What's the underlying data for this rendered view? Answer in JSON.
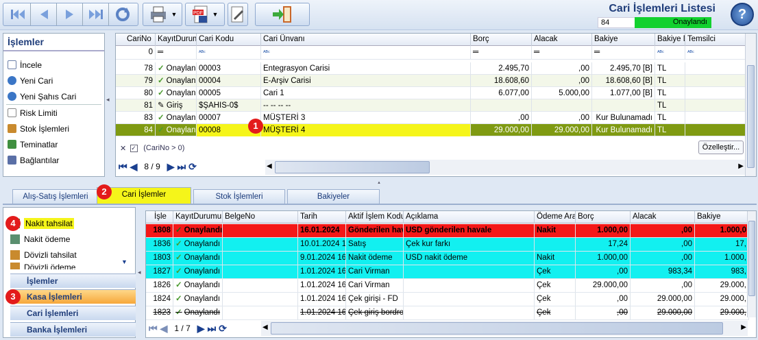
{
  "header": {
    "title": "Cari İşlemleri Listesi",
    "count": "84",
    "status": "Onaylandı"
  },
  "left_panel": {
    "title": "İşlemler",
    "items": [
      {
        "label": "İncele",
        "icon": "list-icon",
        "color": "#6b7fa8"
      },
      {
        "label": "Yeni Cari",
        "icon": "add-icon",
        "color": "#3b76c6"
      },
      {
        "label": "Yeni Şahıs Cari",
        "icon": "add-icon",
        "color": "#3b76c6"
      },
      {
        "label": "Risk Limiti",
        "icon": "limit-icon",
        "color": "#8e8e8e"
      },
      {
        "label": "Stok İşlemleri",
        "icon": "stock-icon",
        "color": "#c98a2e"
      },
      {
        "label": "Teminatlar",
        "icon": "money-icon",
        "color": "#3f8f3f"
      },
      {
        "label": "Bağlantılar",
        "icon": "link-icon",
        "color": "#5a6fa6"
      }
    ]
  },
  "top_grid": {
    "columns": [
      "CariNo",
      "KayıtDurumu",
      "Cari Kodu",
      "Cari Ünvanı",
      "Borç",
      "Alacak",
      "Bakiye",
      "Bakiye D",
      "Temsilci"
    ],
    "filter_row": {
      "carino": "0"
    },
    "rows": [
      {
        "carino": "78",
        "durum": "Onaylan",
        "kod": "00003",
        "unvan": "Entegrasyon Carisi",
        "borc": "2.495,70",
        "alacak": ",00",
        "bakiye": "2.495,70 [B]",
        "bd": "TL",
        "temsilci": ""
      },
      {
        "carino": "79",
        "durum": "Onaylan",
        "kod": "00004",
        "unvan": "E-Arşiv Carisi",
        "borc": "18.608,60",
        "alacak": ",00",
        "bakiye": "18.608,60 [B]",
        "bd": "TL",
        "temsilci": ""
      },
      {
        "carino": "80",
        "durum": "Onaylan",
        "kod": "00005",
        "unvan": "Cari 1",
        "borc": "6.077,00",
        "alacak": "5.000,00",
        "bakiye": "1.077,00 [B]",
        "bd": "TL",
        "temsilci": ""
      },
      {
        "carino": "81",
        "durum": "Giriş",
        "kod": "$ŞAHIS-0$",
        "unvan": "-- -- -- --",
        "borc": "",
        "alacak": "",
        "bakiye": "",
        "bd": "TL",
        "temsilci": ""
      },
      {
        "carino": "83",
        "durum": "Onaylan",
        "kod": "00007",
        "unvan": "MÜŞTERİ 3",
        "borc": ",00",
        "alacak": ",00",
        "bakiye": "Kur Bulunamadı",
        "bd": "TL",
        "temsilci": ""
      },
      {
        "carino": "84",
        "durum": "Onaylan",
        "kod": "00008",
        "unvan": "MÜŞTERİ 4",
        "borc": "29.000,00",
        "alacak": "29.000,00",
        "bakiye": "Kur Bulunamadı",
        "bd": "TL",
        "temsilci": ""
      }
    ],
    "filter_text": "(CariNo > 0)",
    "customize": "Özelleştir...",
    "page": "8 / 9"
  },
  "tabs": [
    "Alış-Satış İşlemleri",
    "Cari İşlemler",
    "Stok İşlemleri",
    "Bakiyeler"
  ],
  "bottom_left": {
    "items": [
      "Nakit tahsilat",
      "Nakit ödeme",
      "Dövizli tahsilat",
      "Dövizli ödeme"
    ],
    "nav": [
      "İşlemler",
      "Kasa İşlemleri",
      "Cari İşlemleri",
      "Banka İşlemleri"
    ]
  },
  "bottom_grid": {
    "columns": [
      "İşle",
      "KayıtDurumu",
      "BelgeNo",
      "Tarih",
      "Aktif İşlem Kodu",
      "Açıklama",
      "Ödeme Ara",
      "Borç",
      "Alacak",
      "Bakiye"
    ],
    "rows": [
      {
        "no": "1808",
        "durum": "Onaylandı",
        "belge": "",
        "tarih": "16.01.2024",
        "kod": "Gönderilen hav",
        "acik": "USD gönderilen havale",
        "odeme": "Nakit",
        "borc": "1.000,00",
        "alacak": ",00",
        "bakiye": "1.000,0"
      },
      {
        "no": "1836",
        "durum": "Onaylandı",
        "belge": "",
        "tarih": "10.01.2024 1",
        "kod": "Satış",
        "acik": "Çek kur farkı",
        "odeme": "",
        "borc": "17,24",
        "alacak": ",00",
        "bakiye": "17,"
      },
      {
        "no": "1803",
        "durum": "Onaylandı",
        "belge": "",
        "tarih": "9.01.2024 16",
        "kod": "Nakit ödeme",
        "acik": "USD nakit ödeme",
        "odeme": "Nakit",
        "borc": "1.000,00",
        "alacak": ",00",
        "bakiye": "1.000,"
      },
      {
        "no": "1827",
        "durum": "Onaylandı",
        "belge": "",
        "tarih": "1.01.2024 16",
        "kod": "Cari Virman",
        "acik": "",
        "odeme": "Çek",
        "borc": ",00",
        "alacak": "983,34",
        "bakiye": "983,"
      },
      {
        "no": "1826",
        "durum": "Onaylandı",
        "belge": "",
        "tarih": "1.01.2024 16",
        "kod": "Cari Virman",
        "acik": "",
        "odeme": "Çek",
        "borc": "29.000,00",
        "alacak": ",00",
        "bakiye": "29.000,"
      },
      {
        "no": "1824",
        "durum": "Onaylandı",
        "belge": "",
        "tarih": "1.01.2024 16",
        "kod": "Çek girişi - FD",
        "acik": "",
        "odeme": "Çek",
        "borc": ",00",
        "alacak": "29.000,00",
        "bakiye": "29.000,"
      },
      {
        "no": "1823",
        "durum": "Onaylandı",
        "belge": "",
        "tarih": "1.01.2024 16",
        "kod": "Çek giriş bordros",
        "acik": "",
        "odeme": "Çek",
        "borc": ",00",
        "alacak": "29.000,00",
        "bakiye": "29.000,"
      }
    ],
    "page": "1 / 7"
  },
  "badges": [
    "1",
    "2",
    "3",
    "4"
  ],
  "colors": {
    "selected_row": "#7f9a12",
    "highlight_yellow": "#f5f51a",
    "red_row": "#f41818",
    "cyan_row": "#12f0f0",
    "ok_green": "#12d12e"
  }
}
